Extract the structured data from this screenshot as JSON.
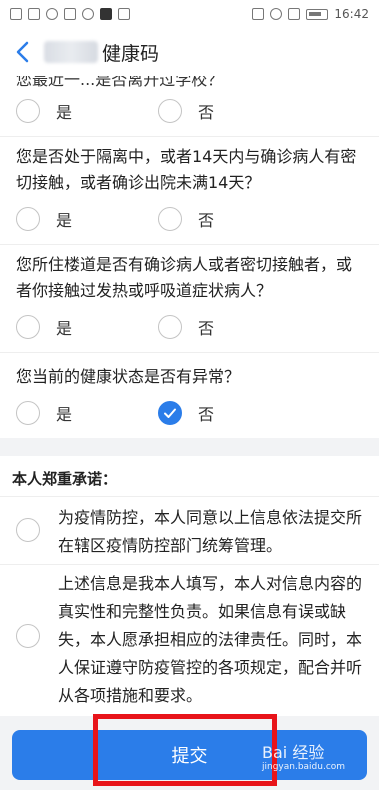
{
  "status_bar": {
    "time": "16:42"
  },
  "header": {
    "title": "健康码"
  },
  "questions": [
    {
      "text": "您最近一...是否离开过学校？",
      "yes": "是",
      "no": "否"
    },
    {
      "text": "您是否处于隔离中，或者14天内与确诊病人有密切接触，或者确诊出院未满14天？",
      "yes": "是",
      "no": "否"
    },
    {
      "text": "您所住楼道是否有确诊病人或者密切接触者，或者你接触过发热或呼吸道症状病人？",
      "yes": "是",
      "no": "否"
    },
    {
      "text": "您当前的健康状态是否有异常？",
      "yes": "是",
      "no": "否"
    }
  ],
  "promise": {
    "title": "本人郑重承诺：",
    "items": [
      "为疫情防控，本人同意以上信息依法提交所在辖区疫情防控部门统筹管理。",
      "上述信息是我本人填写，本人对信息内容的真实性和完整性负责。如果信息有误或缺失，本人愿承担相应的法律责任。同时，本人保证遵守防疫管控的各项规定，配合并听从各项措施和要求。"
    ]
  },
  "submit_label": "提交",
  "watermark": {
    "brand": "Bai 经验",
    "url": "jingyan.baidu.com"
  },
  "colors": {
    "accent": "#2b7de9",
    "highlight": "#e8141a"
  }
}
